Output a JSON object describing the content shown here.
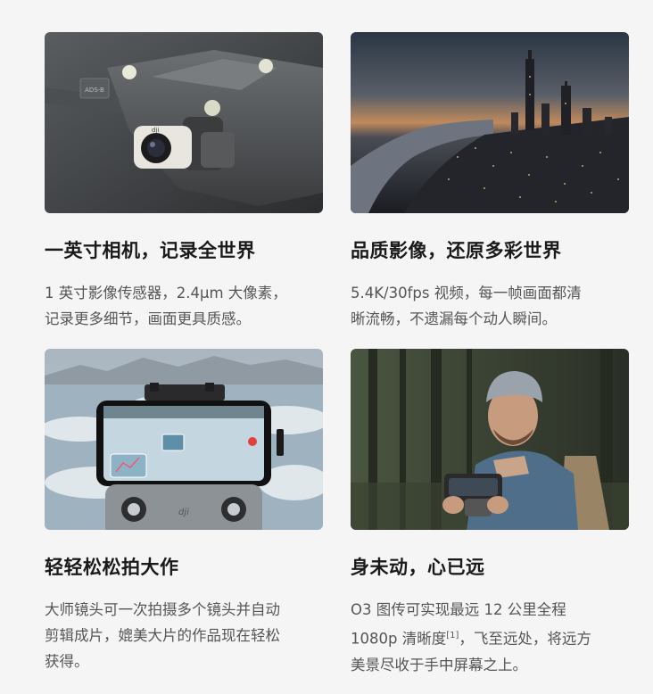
{
  "features": [
    {
      "title": "一英寸相机，记录全世界",
      "desc_lines": [
        "1 英寸影像传感器，2.4μm 大像素，",
        "记录更多细节，画面更具质感。"
      ]
    },
    {
      "title": "品质影像，还原多彩世界",
      "desc_lines": [
        "5.4K/30fps 视频，每一帧画面都清",
        "晰流畅，不遗漏每个动人瞬间。"
      ]
    },
    {
      "title": "轻轻松松拍大作",
      "desc_lines": [
        "大师镜头可一次拍摄多个镜头并自动",
        "剪辑成片，媲美大片的作品现在轻松",
        "获得。"
      ]
    },
    {
      "title": "身未动，心已远",
      "desc_line1": "O3 图传可实现最远 12 公里全程",
      "desc_line2_pre": "1080p 清晰度",
      "desc_line2_sup": "[1]",
      "desc_line2_post": "，飞至远处，将远方",
      "desc_line3": "美景尽收于手中屏幕之上。"
    }
  ],
  "images": {
    "drone": {
      "label": "ADS-B",
      "brand": "dji"
    },
    "controller": {
      "brand": "dji"
    }
  },
  "colors": {
    "background": "#f5f5f5",
    "title": "#1a1a1a",
    "body_text": "#555555"
  }
}
